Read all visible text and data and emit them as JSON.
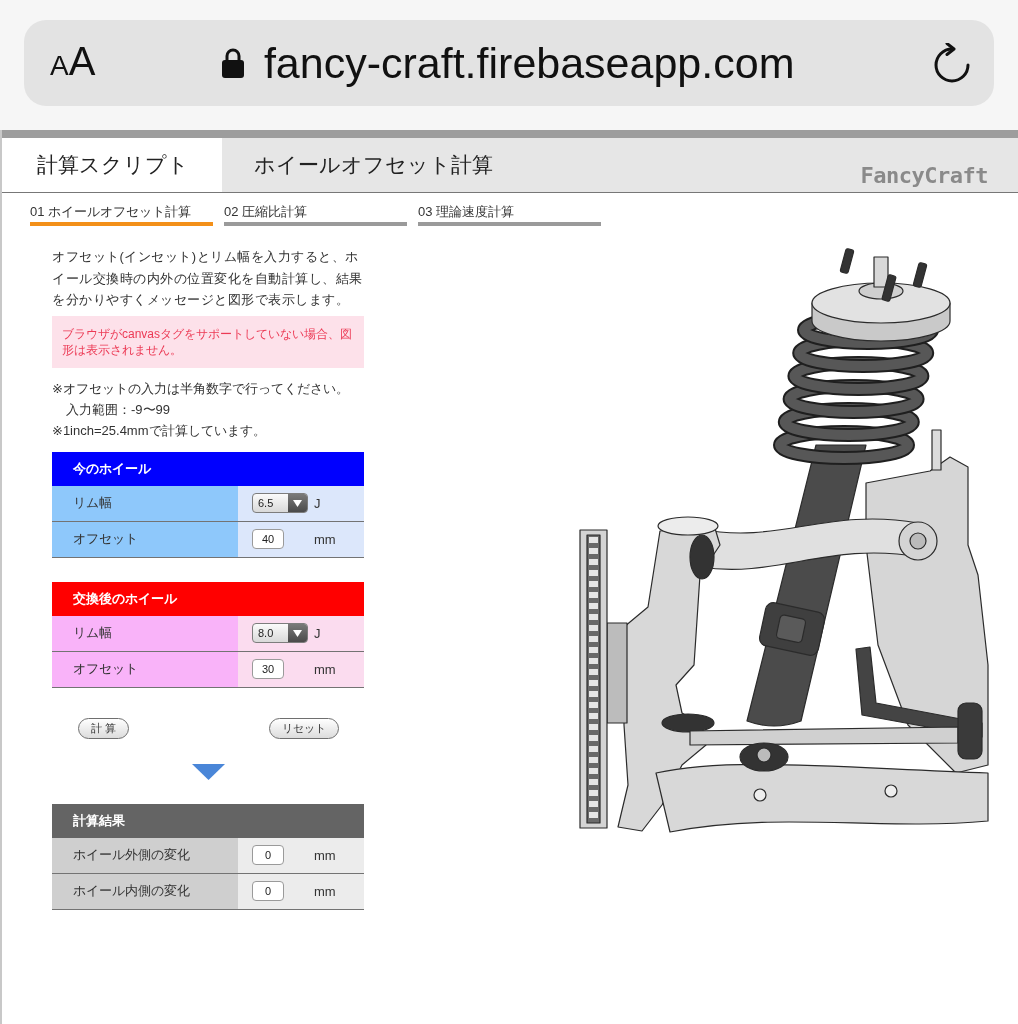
{
  "browser": {
    "text_size_label": "AA",
    "url": "fancy-craft.firebaseapp.com"
  },
  "site_tabs": [
    {
      "label": "計算スクリプト",
      "selected": true
    },
    {
      "label": "ホイールオフセット計算",
      "selected": false
    }
  ],
  "logo": "FancyCraft",
  "step_tabs": [
    {
      "label": "01 ホイールオフセット計算",
      "selected": true
    },
    {
      "label": "02 圧縮比計算",
      "selected": false
    },
    {
      "label": "03 理論速度計算",
      "selected": false
    }
  ],
  "intro": "オフセット(インセット)とリム幅を入力すると、ホイール交換時の内外の位置変化を自動計算し、結果を分かりやすくメッセージと図形で表示します。",
  "notice": "ブラウザがcanvasタグをサポートしていない場合、図形は表示されません。",
  "notes": [
    {
      "text": "※オフセットの入力は半角数字で行ってください。",
      "children": [
        {
          "text": "入力範囲：-9〜99"
        }
      ]
    },
    {
      "text": "※1inch=25.4mmで計算しています。"
    }
  ],
  "forms": [
    {
      "title": "今のホイール",
      "color": "#0000ff",
      "rows": [
        {
          "label": "リム幅",
          "kind": "select",
          "value": "6.5",
          "unit": "J"
        },
        {
          "label": "オフセット",
          "kind": "input",
          "value": "40",
          "unit": "mm"
        }
      ]
    },
    {
      "title": "交換後のホイール",
      "color": "#ff0000",
      "rows": [
        {
          "label": "リム幅",
          "kind": "select",
          "value": "8.0",
          "unit": "J"
        },
        {
          "label": "オフセット",
          "kind": "input",
          "value": "30",
          "unit": "mm"
        }
      ]
    }
  ],
  "buttons": [
    {
      "label": "計 算"
    },
    {
      "label": "リセット"
    }
  ],
  "result": {
    "title": "計算結果",
    "color": "#646464",
    "rows": [
      {
        "label": "ホイール外側の変化",
        "kind": "input",
        "value": "0",
        "unit": "mm"
      },
      {
        "label": "ホイール内側の変化",
        "kind": "input",
        "value": "0",
        "unit": "mm"
      }
    ]
  }
}
